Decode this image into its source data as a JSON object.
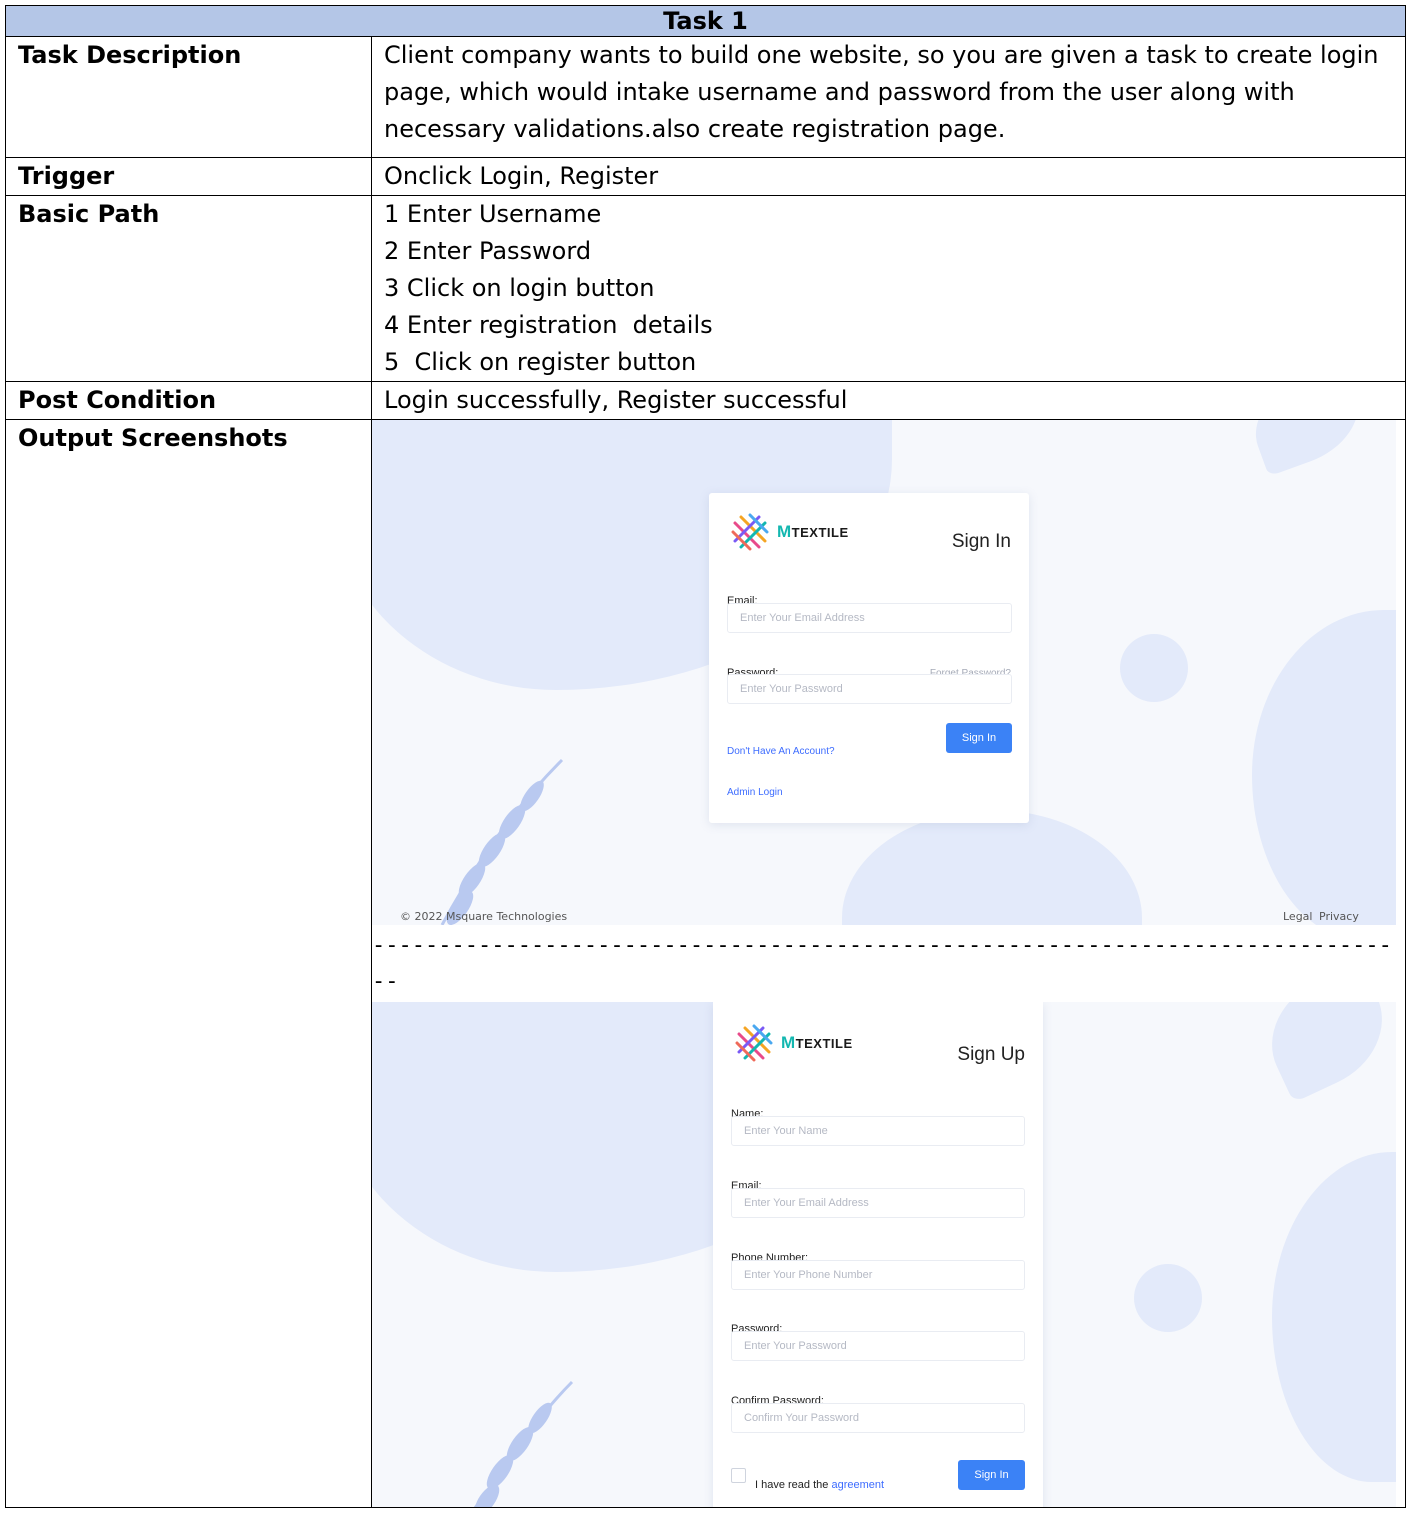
{
  "table": {
    "header": "Task 1",
    "rows": {
      "description": {
        "label": "Task Description",
        "text": "Client company wants to build one website, so you are given a task to create login page, which would intake username and password from the user along with necessary validations.also create registration page."
      },
      "trigger": {
        "label": "Trigger",
        "text": "Onclick Login, Register"
      },
      "basic_path": {
        "label": "Basic Path",
        "steps": [
          "1 Enter Username",
          "2 Enter Password",
          "3 Click on login button",
          "4 Enter registration  details",
          "5  Click on register button"
        ]
      },
      "post_condition": {
        "label": "Post Condition",
        "text": "Login successfully, Register successful"
      },
      "output": {
        "label": "Output Screenshots"
      }
    }
  },
  "separator": "--------------------------------------------------------------------------------------------------------\n--",
  "signin": {
    "brand": "TEXTILE",
    "brand_initial": "M",
    "title": "Sign In",
    "email_label": "Email:",
    "email_placeholder": "Enter Your Email Address",
    "password_label": "Password:",
    "forget_password": "Forget Password?",
    "password_placeholder": "Enter Your Password",
    "no_account": "Don't Have An Account?",
    "sign_in_button": "Sign In",
    "admin_login": "Admin Login",
    "copyright": "© 2022 Msquare Technologies",
    "legal": "Legal",
    "privacy": "Privacy"
  },
  "signup": {
    "brand": "TEXTILE",
    "brand_initial": "M",
    "title": "Sign Up",
    "name_label": "Name:",
    "name_placeholder": "Enter Your Name",
    "email_label": "Email:",
    "email_placeholder": "Enter Your Email Address",
    "phone_label": "Phone Number:",
    "phone_placeholder": "Enter Your Phone Number",
    "password_label": "Password:",
    "password_placeholder": "Enter Your Password",
    "confirm_label": "Confirm Password:",
    "confirm_placeholder": "Confirm Your Password",
    "agree_prefix": "I have read the ",
    "agree_link": "agreement",
    "submit_button": "Sign In"
  }
}
